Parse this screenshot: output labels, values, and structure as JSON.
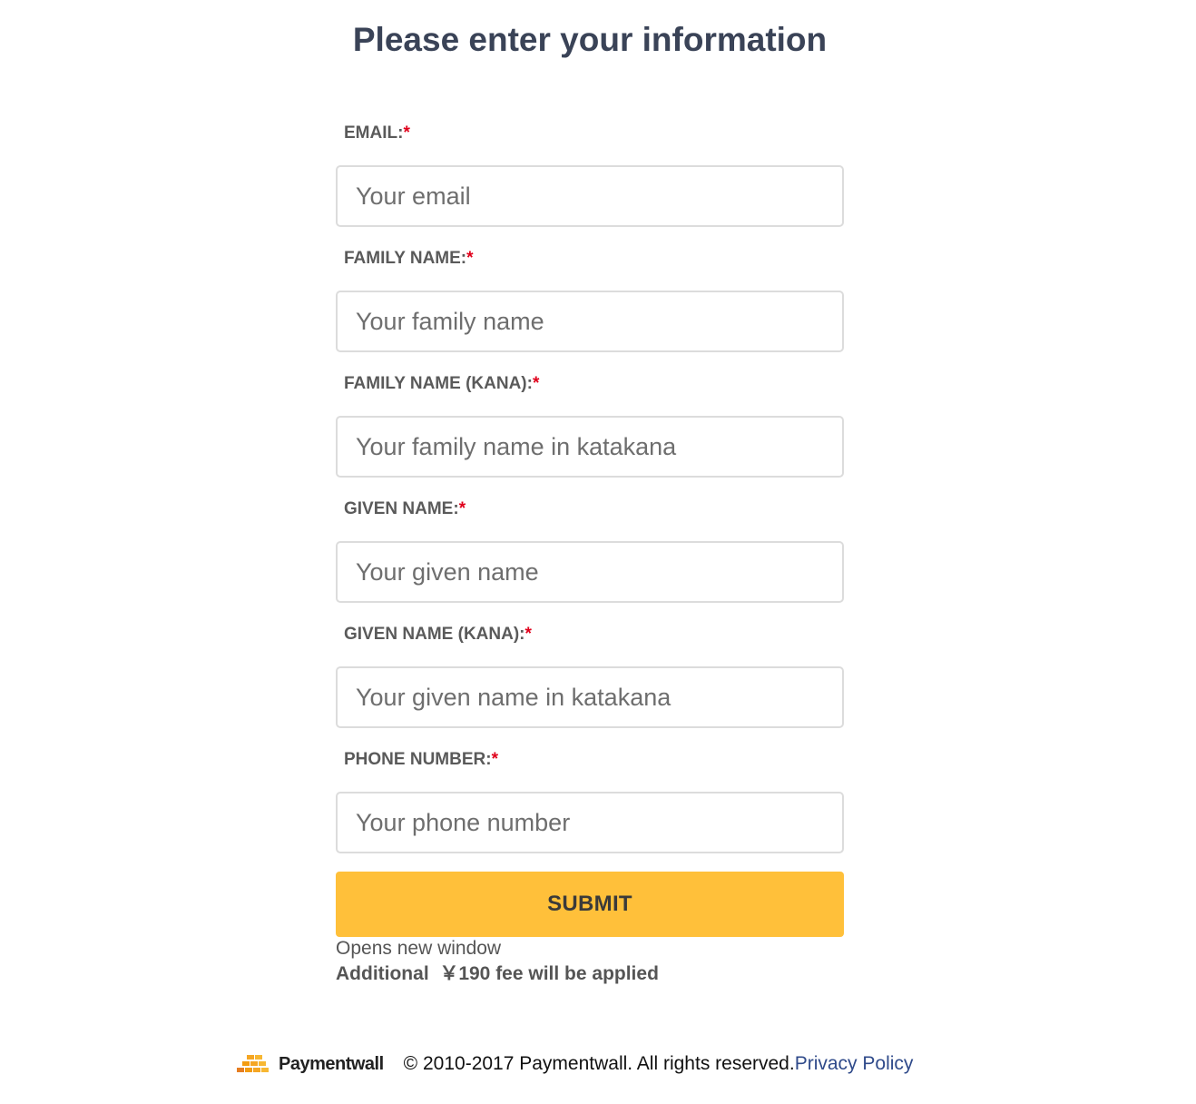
{
  "page": {
    "title": "Please enter your information"
  },
  "form": {
    "required_marker": "*",
    "fields": [
      {
        "label": "EMAIL:",
        "placeholder": "Your email"
      },
      {
        "label": "FAMILY NAME:",
        "placeholder": "Your family name"
      },
      {
        "label": "FAMILY NAME (KANA):",
        "placeholder": "Your family name in katakana"
      },
      {
        "label": "GIVEN NAME:",
        "placeholder": "Your given name"
      },
      {
        "label": "GIVEN NAME (KANA):",
        "placeholder": "Your given name in katakana"
      },
      {
        "label": "PHONE NUMBER:",
        "placeholder": "Your phone number"
      }
    ],
    "submit_label": "SUBMIT",
    "opens_note": "Opens new window",
    "fee_note": "Additional  ￥190 fee will be applied"
  },
  "footer": {
    "logo_text": "Paymentwall",
    "copyright": "© 2010-2017 Paymentwall. All rights reserved.",
    "privacy_link": "Privacy Policy"
  },
  "colors": {
    "title": "#3a4357",
    "required": "#e0001b",
    "submit_bg": "#ffc03a",
    "link": "#2f4a8a",
    "logo_accent": "#f5a623"
  }
}
